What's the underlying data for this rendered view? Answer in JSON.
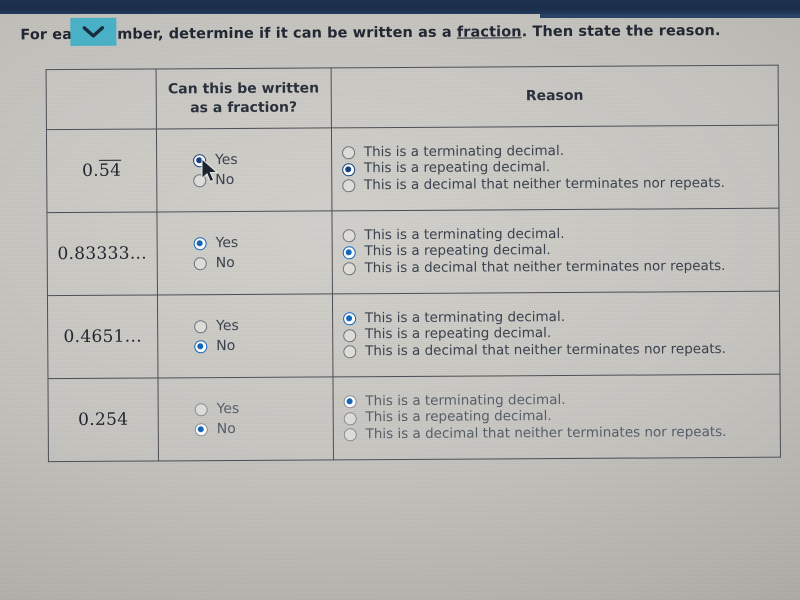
{
  "prompt": {
    "before_link": "For each number, determine if it can be written as a ",
    "link_text": "fraction",
    "after_link": ". Then state the reason.",
    "full_text": "For each number, determine if it can be written as a fraction. Then state the reason."
  },
  "dropdown": {
    "icon": "chevron-down-icon",
    "color": "#4ab0c6"
  },
  "table": {
    "headers": {
      "number": "",
      "question": "Can this be written as a fraction?",
      "reason": "Reason"
    },
    "yes_label": "Yes",
    "no_label": "No",
    "reason_options": [
      "This is a terminating decimal.",
      "This is a repeating decimal.",
      "This is a decimal that neither terminates nor repeats."
    ],
    "rows": [
      {
        "number_prefix": "0.",
        "number_repeating": "54",
        "number_suffix": "",
        "number_display": "0.54 (repeating)",
        "yes_selected": true,
        "no_selected": false,
        "reason_selected_index": 1
      },
      {
        "number_prefix": "0.83333",
        "number_repeating": "",
        "number_suffix": "...",
        "number_display": "0.83333...",
        "yes_selected": true,
        "no_selected": false,
        "reason_selected_index": 1
      },
      {
        "number_prefix": "0.4651",
        "number_repeating": "",
        "number_suffix": "...",
        "number_display": "0.4651...",
        "yes_selected": false,
        "no_selected": true,
        "reason_selected_index": 0
      },
      {
        "number_prefix": "0.254",
        "number_repeating": "",
        "number_suffix": "",
        "number_display": "0.254",
        "yes_selected": false,
        "no_selected": true,
        "reason_selected_index": 0
      }
    ]
  },
  "colors": {
    "accent_blue": "#1565b8",
    "teal_button": "#4ab0c6",
    "chrome_navy": "#1e3352",
    "text": "#2a313d"
  }
}
